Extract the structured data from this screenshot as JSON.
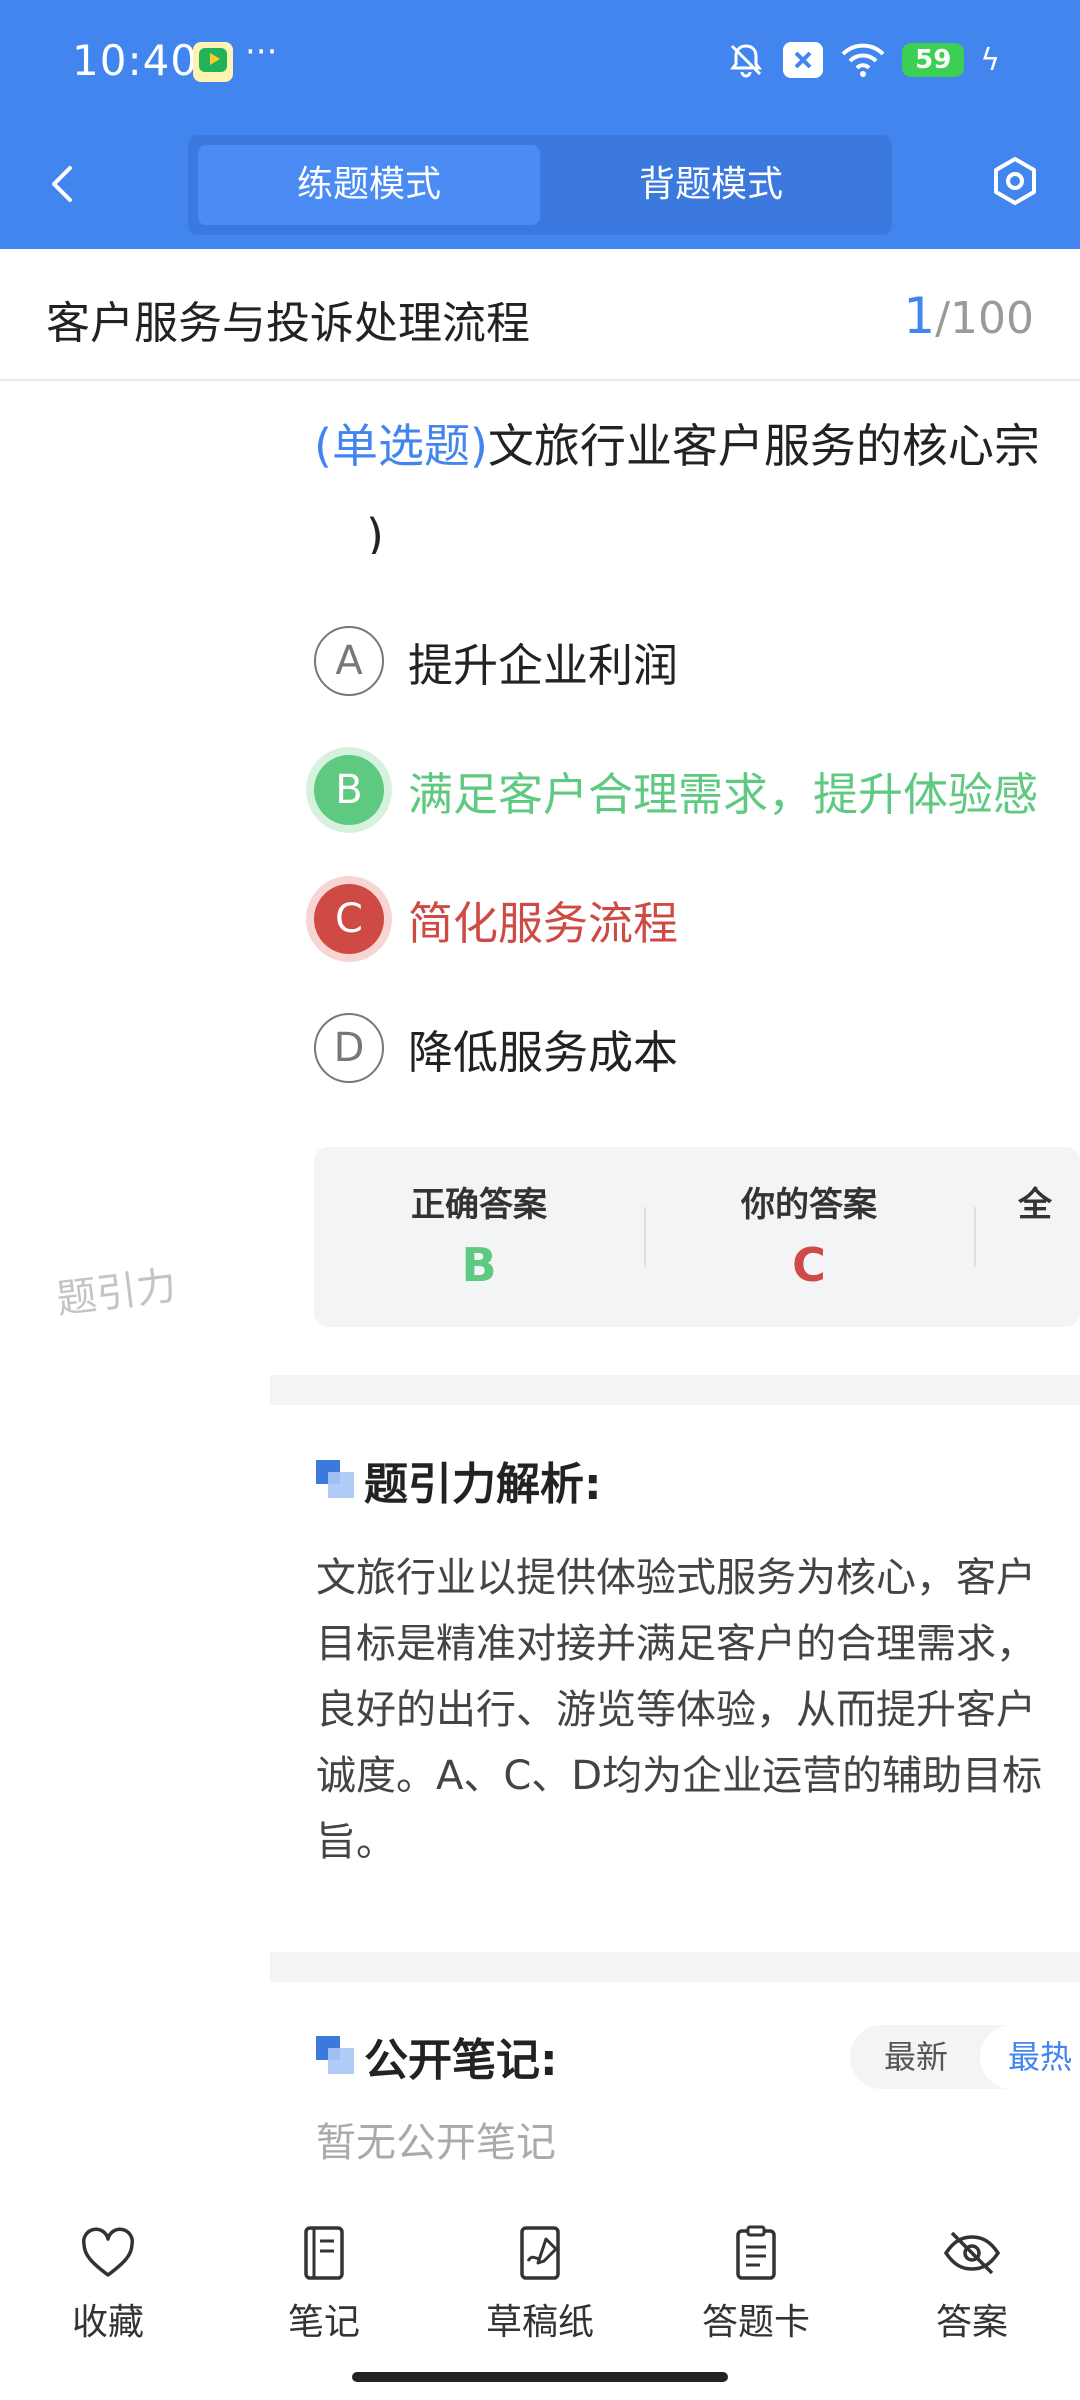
{
  "status_bar": {
    "time": "10:40",
    "dots": "···",
    "battery": "59"
  },
  "header": {
    "tab_practice": "练题模式",
    "tab_memorize": "背题模式"
  },
  "title_bar": {
    "title": "客户服务与投诉处理流程",
    "current": "1",
    "total": "/100"
  },
  "question": {
    "type": "(单选题)",
    "text": "文旅行业客户服务的核心宗",
    "continuation": ")"
  },
  "options": [
    {
      "letter": "A",
      "text": "提升企业利润",
      "state": "normal"
    },
    {
      "letter": "B",
      "text": "满足客户合理需求，提升体验感",
      "state": "correct"
    },
    {
      "letter": "C",
      "text": "简化服务流程",
      "state": "wrong"
    },
    {
      "letter": "D",
      "text": "降低服务成本",
      "state": "normal"
    }
  ],
  "answer_box": {
    "correct_label": "正确答案",
    "correct_value": "B",
    "yours_label": "你的答案",
    "yours_value": "C",
    "third_label": "全"
  },
  "watermark": "题引力",
  "analysis": {
    "title": "题引力解析:",
    "lines": [
      "文旅行业以提供体验式服务为核心，客户",
      "目标是精准对接并满足客户的合理需求，",
      "良好的出行、游览等体验，从而提升客户",
      "诚度。A、C、D均为企业运营的辅助目标",
      "旨。"
    ]
  },
  "notes": {
    "title": "公开笔记:",
    "sort_new": "最新",
    "sort_hot": "最热",
    "empty": "暂无公开笔记"
  },
  "bottom_nav": [
    {
      "label": "收藏",
      "icon": "heart-icon"
    },
    {
      "label": "笔记",
      "icon": "notebook-icon"
    },
    {
      "label": "草稿纸",
      "icon": "draft-icon"
    },
    {
      "label": "答题卡",
      "icon": "answer-card-icon"
    },
    {
      "label": "答案",
      "icon": "eye-off-icon"
    }
  ],
  "colors": {
    "primary": "#4285ef",
    "correct": "#5ec981",
    "wrong": "#cf4a45"
  }
}
